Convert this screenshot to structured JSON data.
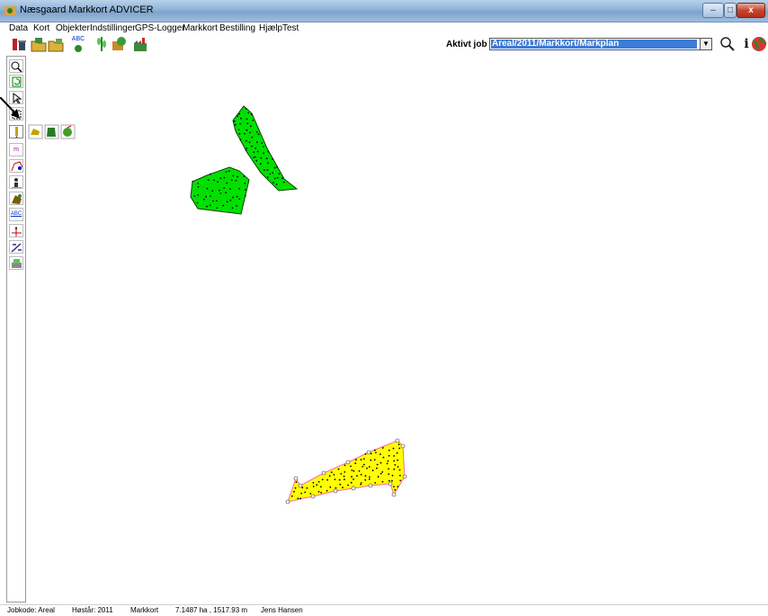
{
  "window": {
    "title": "Næsgaard Markkort ADVICER",
    "minimize_label": "–",
    "maximize_label": "□",
    "close_label": "x"
  },
  "menu": {
    "items": [
      "Data",
      "Kort",
      "Objekter",
      "Indstillinger",
      "GPS-Logger",
      "Markkort",
      "Bestilling",
      "Hjælp",
      "Test"
    ]
  },
  "toolbar": {
    "abc_label": "ABC",
    "job_label": "Aktivt job",
    "job_value": "Areal/2011/Markkort/Markplan",
    "info_label": "i"
  },
  "left_tools": {
    "abc_label": "ABC",
    "measure_label": "m"
  },
  "colors": {
    "field_green": "#00e000",
    "field_yellow": "#ffff00",
    "selection_outline": "#ff66aa",
    "job_highlight": "#3d7bd8"
  },
  "status": {
    "jobkode": "Jobkode: Areal",
    "hoestaar": "Høstår: 2011",
    "view": "Markkort",
    "area": "7.1487 ha , 1517.93 m",
    "user": "Jens Hansen"
  }
}
